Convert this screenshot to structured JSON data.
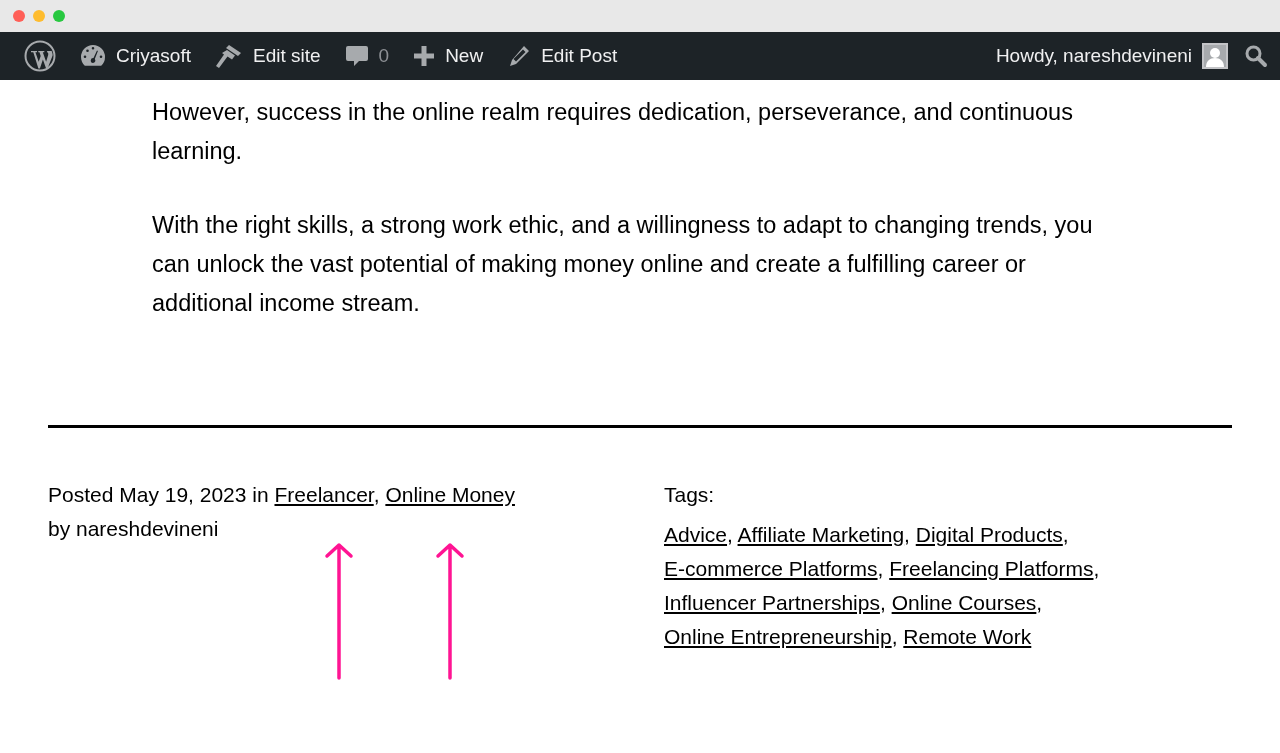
{
  "admin_bar": {
    "left": [
      {
        "kind": "wp-logo"
      },
      {
        "kind": "dashboard",
        "label": "Criyasoft"
      },
      {
        "kind": "brush",
        "label": "Edit site"
      },
      {
        "kind": "comments",
        "label": "0"
      },
      {
        "kind": "plus",
        "label": "New"
      },
      {
        "kind": "pencil",
        "label": "Edit Post"
      }
    ],
    "account": {
      "label": "Howdy, nareshdevineni"
    }
  },
  "content": {
    "paragraphs": [
      "However, success in the online realm requires dedication, perseverance, and continuous learning.",
      "With the right skills, a strong work ethic, and a willingness to adapt to changing trends, you can unlock the vast potential of making money online and create a fulfilling career or additional income stream."
    ]
  },
  "post_meta": {
    "posted": "Posted May 19, 2023 in",
    "categories": [
      {
        "label": "Freelancer",
        "separator": ","
      },
      {
        "label": "Online Money"
      }
    ],
    "byline": "by nareshdevineni",
    "tags_label": "Tags:",
    "tags": [
      {
        "label": "Advice",
        "separator": ","
      },
      {
        "label": "Affiliate Marketing",
        "separator": ","
      },
      {
        "label": "Digital Products",
        "separator": ","
      },
      {
        "label": "E-commerce Platforms",
        "separator": ","
      },
      {
        "label": "Freelancing Platforms",
        "separator": ","
      },
      {
        "label": "Influencer Partnerships",
        "separator": ","
      },
      {
        "label": "Online Courses",
        "separator": ","
      },
      {
        "label": "Online Entrepreneurship",
        "separator": ","
      },
      {
        "label": "Remote Work"
      }
    ]
  },
  "annotations": [
    {
      "kind": "arrow"
    },
    {
      "kind": "arrow"
    }
  ]
}
